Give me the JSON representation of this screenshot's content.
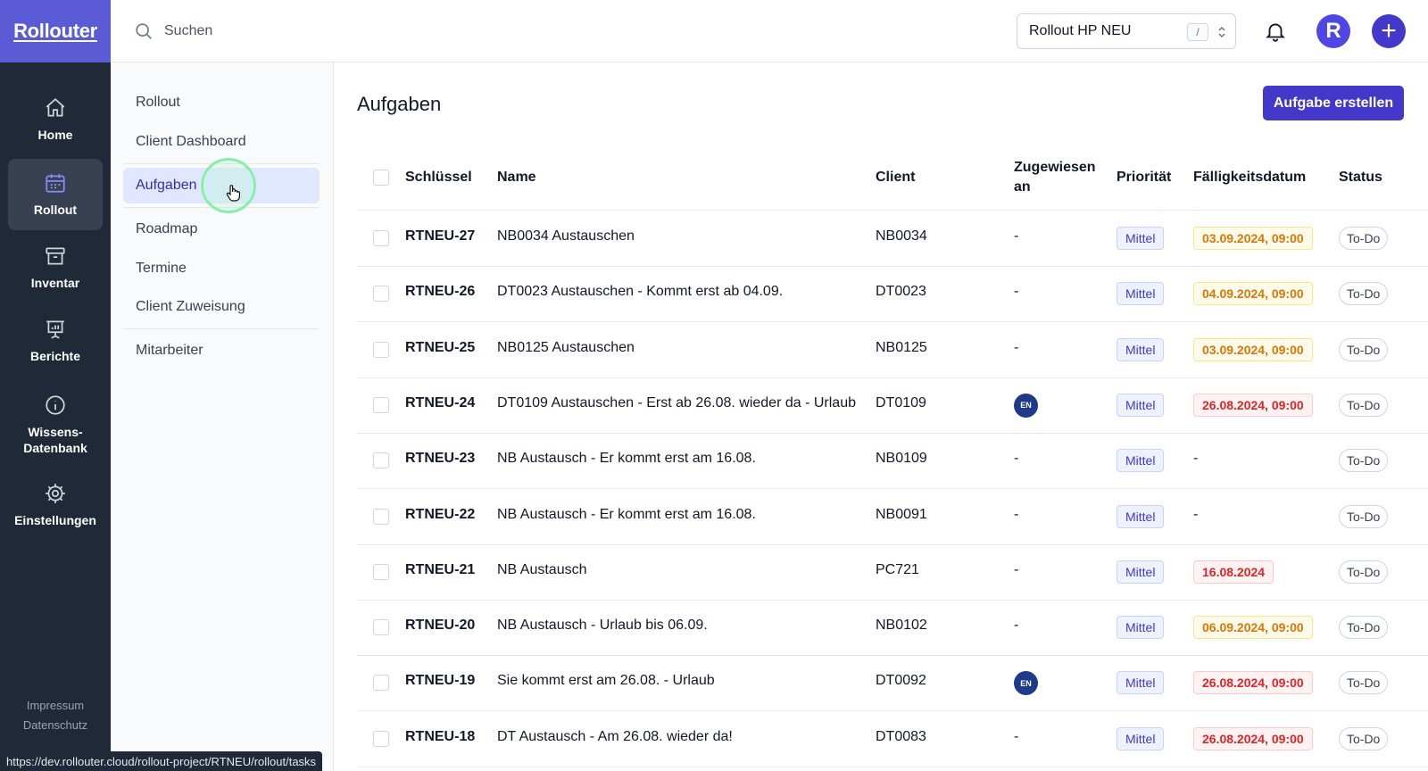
{
  "app": {
    "logo": "Rollouter"
  },
  "nav": {
    "items": [
      {
        "label": "Home",
        "icon": "home-icon"
      },
      {
        "label": "Rollout",
        "icon": "calendar-icon"
      },
      {
        "label": "Inventar",
        "icon": "archive-icon"
      },
      {
        "label": "Berichte",
        "icon": "presentation-chart-icon"
      },
      {
        "label": "Wissens-\nDatenbank",
        "icon": "info-icon"
      },
      {
        "label": "Einstellungen",
        "icon": "gear-icon"
      }
    ],
    "active": "Rollout",
    "footer": {
      "impressum": "Impressum",
      "datenschutz": "Datenschutz"
    }
  },
  "topbar": {
    "search_placeholder": "Suchen",
    "project": "Rollout HP NEU",
    "shortcut": "/",
    "avatar_letter": "R",
    "add_label": "+"
  },
  "subnav": {
    "items": [
      "Rollout",
      "Client Dashboard",
      "Aufgaben",
      "Roadmap",
      "Termine",
      "Client Zuweisung",
      "Mitarbeiter"
    ],
    "active": "Aufgaben"
  },
  "main": {
    "title": "Aufgaben",
    "create_button": "Aufgabe erstellen",
    "columns": {
      "key": "Schlüssel",
      "name": "Name",
      "client": "Client",
      "assigned_line1": "Zugewiesen",
      "assigned_line2": "an",
      "priority": "Priorität",
      "due": "Fälligkeitsdatum",
      "status": "Status"
    },
    "rows": [
      {
        "key": "RTNEU-27",
        "name": "NB0034 Austauschen",
        "client": "NB0034",
        "assigned": "-",
        "priority": "Mittel",
        "due": "03.09.2024, 09:00",
        "due_state": "warn",
        "status": "To-Do"
      },
      {
        "key": "RTNEU-26",
        "name": "DT0023 Austauschen - Kommt erst ab 04.09.",
        "client": "DT0023",
        "assigned": "-",
        "priority": "Mittel",
        "due": "04.09.2024, 09:00",
        "due_state": "warn",
        "status": "To-Do"
      },
      {
        "key": "RTNEU-25",
        "name": "NB0125 Austauschen",
        "client": "NB0125",
        "assigned": "-",
        "priority": "Mittel",
        "due": "03.09.2024, 09:00",
        "due_state": "warn",
        "status": "To-Do"
      },
      {
        "key": "RTNEU-24",
        "name": "DT0109 Austauschen - Erst ab 26.08. wieder da - Urlaub",
        "client": "DT0109",
        "assigned": "EN",
        "priority": "Mittel",
        "due": "26.08.2024, 09:00",
        "due_state": "late",
        "status": "To-Do"
      },
      {
        "key": "RTNEU-23",
        "name": "NB Austausch - Er kommt erst am 16.08.",
        "client": "NB0109",
        "assigned": "-",
        "priority": "Mittel",
        "due": "-",
        "due_state": "none",
        "status": "To-Do"
      },
      {
        "key": "RTNEU-22",
        "name": "NB Austausch - Er kommt erst am 16.08.",
        "client": "NB0091",
        "assigned": "-",
        "priority": "Mittel",
        "due": "-",
        "due_state": "none",
        "status": "To-Do"
      },
      {
        "key": "RTNEU-21",
        "name": "NB Austausch",
        "client": "PC721",
        "assigned": "-",
        "priority": "Mittel",
        "due": "16.08.2024",
        "due_state": "late",
        "status": "To-Do"
      },
      {
        "key": "RTNEU-20",
        "name": "NB Austausch - Urlaub bis 06.09.",
        "client": "NB0102",
        "assigned": "-",
        "priority": "Mittel",
        "due": "06.09.2024, 09:00",
        "due_state": "warn",
        "status": "To-Do"
      },
      {
        "key": "RTNEU-19",
        "name": "Sie kommt erst am 26.08. - Urlaub",
        "client": "DT0092",
        "assigned": "EN",
        "priority": "Mittel",
        "due": "26.08.2024, 09:00",
        "due_state": "late",
        "status": "To-Do"
      },
      {
        "key": "RTNEU-18",
        "name": "DT Austausch - Am 26.08. wieder da!",
        "client": "DT0083",
        "assigned": "-",
        "priority": "Mittel",
        "due": "26.08.2024, 09:00",
        "due_state": "late",
        "status": "To-Do"
      }
    ]
  },
  "status_bar": {
    "url": "https://dev.rollouter.cloud/rollout-project/RTNEU/rollout/tasks"
  }
}
